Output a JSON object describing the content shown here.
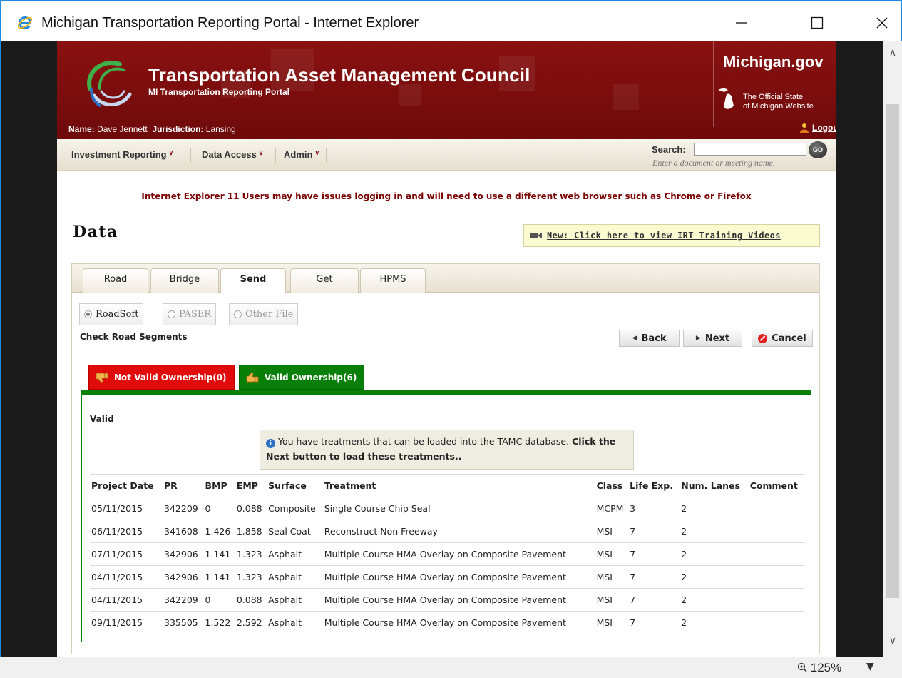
{
  "window": {
    "title": "Michigan Transportation Reporting Portal - Internet Explorer",
    "zoom": "125%"
  },
  "banner": {
    "title": "Transportation Asset Management Council",
    "subtitle": "MI Transportation Reporting Portal",
    "michigan_gov": "Michigan.gov",
    "tagline_1": "The Official State",
    "tagline_2": "of Michigan Website",
    "name_label": "Name:",
    "name_value": "Dave Jennett",
    "jurisdiction_label": "Jurisdiction:",
    "jurisdiction_value": "Lansing",
    "logout": "Logout",
    "brand_color": "#7a0c0c"
  },
  "nav": {
    "items": [
      {
        "label": "Investment Reporting"
      },
      {
        "label": "Data Access"
      },
      {
        "label": "Admin"
      }
    ],
    "search_label": "Search:",
    "search_value": "",
    "search_hint": "Enter a document or meeting name.",
    "go_label": "GO"
  },
  "notice": "Internet Explorer 11 Users may have issues logging in and will need to use a different web browser such as Chrome or Firefox",
  "page_title": "Data",
  "training_link": "New: Click here to view IRT Training Videos",
  "tabs": [
    {
      "label": "Road",
      "active": false
    },
    {
      "label": "Bridge",
      "active": false
    },
    {
      "label": "Send",
      "active": true
    },
    {
      "label": "Get",
      "active": false
    },
    {
      "label": "HPMS",
      "active": false
    }
  ],
  "file_types": [
    {
      "label": "RoadSoft",
      "selected": true
    },
    {
      "label": "PASER",
      "selected": false
    },
    {
      "label": "Other File",
      "selected": false
    }
  ],
  "step_title": "Check Road Segments",
  "buttons": {
    "back": "Back",
    "next": "Next",
    "cancel": "Cancel"
  },
  "ownership_tabs": {
    "not_valid": "Not Valid Ownership(0)",
    "valid": "Valid Ownership(6)",
    "not_valid_color": "#e20b0b",
    "valid_color": "#087f08"
  },
  "valid_label": "Valid",
  "info": {
    "text": "You have treatments that can be loaded into the TAMC database.",
    "bold": "Click the Next button to load these treatments.."
  },
  "table": {
    "headers": [
      "Project Date",
      "PR",
      "BMP",
      "EMP",
      "Surface",
      "Treatment",
      "Class",
      "Life Exp.",
      "Num. Lanes",
      "Comment"
    ],
    "rows": [
      [
        "05/11/2015",
        "342209",
        "0",
        "0.088",
        "Composite",
        "Single Course Chip Seal",
        "MCPM",
        "3",
        "2",
        ""
      ],
      [
        "06/11/2015",
        "341608",
        "1.426",
        "1.858",
        "Seal Coat",
        "Reconstruct Non Freeway",
        "MSI",
        "7",
        "2",
        ""
      ],
      [
        "07/11/2015",
        "342906",
        "1.141",
        "1.323",
        "Asphalt",
        "Multiple Course HMA Overlay on Composite Pavement",
        "MSI",
        "7",
        "2",
        ""
      ],
      [
        "04/11/2015",
        "342906",
        "1.141",
        "1.323",
        "Asphalt",
        "Multiple Course HMA Overlay on Composite Pavement",
        "MSI",
        "7",
        "2",
        ""
      ],
      [
        "04/11/2015",
        "342209",
        "0",
        "0.088",
        "Asphalt",
        "Multiple Course HMA Overlay on Composite Pavement",
        "MSI",
        "7",
        "2",
        ""
      ],
      [
        "09/11/2015",
        "335505",
        "1.522",
        "2.592",
        "Asphalt",
        "Multiple Course HMA Overlay on Composite Pavement",
        "MSI",
        "7",
        "2",
        ""
      ]
    ]
  }
}
